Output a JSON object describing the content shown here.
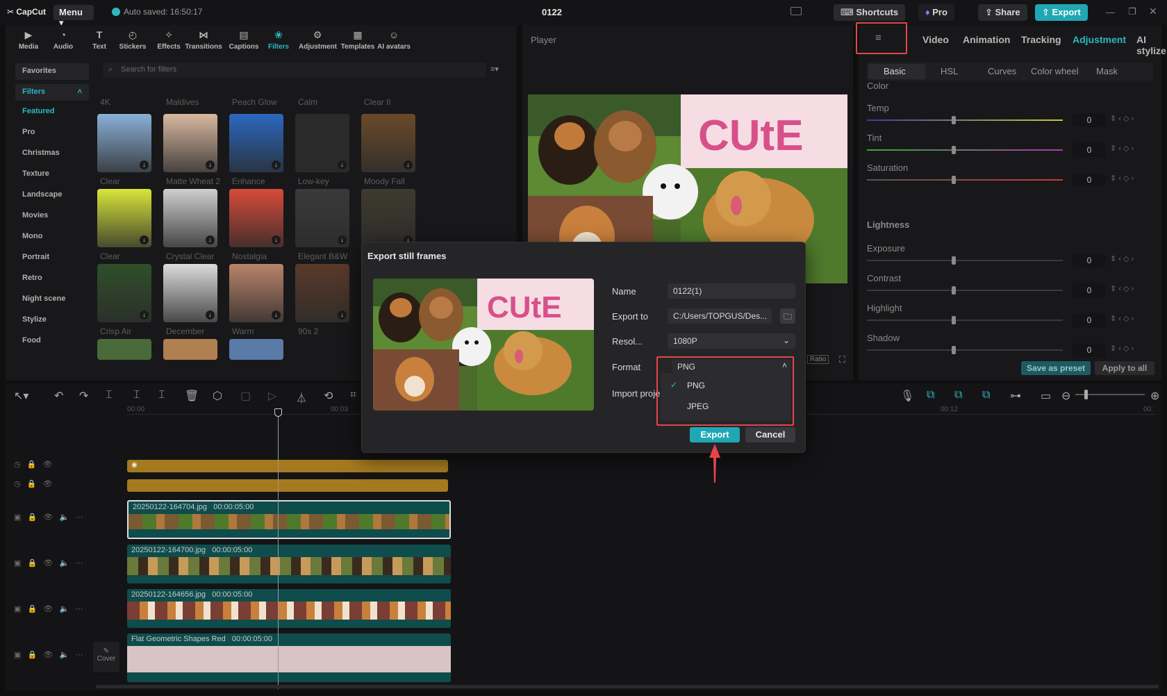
{
  "app": {
    "logo": "CapCut",
    "menu_label": "Menu",
    "autosave": "Auto saved: 16:50:17",
    "project_title": "0122",
    "shortcuts_label": "Shortcuts",
    "pro_label": "Pro",
    "share_label": "Share",
    "export_label": "Export"
  },
  "toolbar": {
    "items": [
      {
        "label": "Media",
        "icon": "media-icon"
      },
      {
        "label": "Audio",
        "icon": "audio-icon"
      },
      {
        "label": "Text",
        "icon": "text-icon"
      },
      {
        "label": "Stickers",
        "icon": "stickers-icon"
      },
      {
        "label": "Effects",
        "icon": "effects-icon"
      },
      {
        "label": "Transitions",
        "icon": "transitions-icon"
      },
      {
        "label": "Captions",
        "icon": "captions-icon"
      },
      {
        "label": "Filters",
        "icon": "filters-icon"
      },
      {
        "label": "Adjustment",
        "icon": "adjustment-icon"
      },
      {
        "label": "Templates",
        "icon": "templates-icon"
      },
      {
        "label": "AI avatars",
        "icon": "ai-avatars-icon"
      }
    ],
    "active": "Filters"
  },
  "sidebar": {
    "favorites": "Favorites",
    "filters": "Filters",
    "categories": [
      "Featured",
      "Pro",
      "Christmas",
      "Texture",
      "Landscape",
      "Movies",
      "Mono",
      "Portrait",
      "Retro",
      "Night scene",
      "Stylize",
      "Food"
    ],
    "active_category": "Featured"
  },
  "search": {
    "placeholder": "Search for filters"
  },
  "filters_grid": [
    [
      "4K",
      "Maldives",
      "Peach Glow",
      "Calm",
      "Clear II"
    ],
    [
      "Clear",
      "Matte Wheat 2",
      "Enhance",
      "Low-key",
      "Moody Fall"
    ],
    [
      "Clear",
      "Crystal Clear",
      "Nostalgia",
      "Elegant B&W",
      ""
    ],
    [
      "Crisp Air",
      "December",
      "Warm",
      "90s 2",
      ""
    ]
  ],
  "player": {
    "label": "Player",
    "ratio_label": "Ratio",
    "collage_word": "CUtE"
  },
  "right_panel": {
    "tabs": [
      "Video",
      "Animation",
      "Tracking",
      "Adjustment",
      "AI stylize"
    ],
    "active_tab": "Adjustment",
    "subtabs": [
      "Basic",
      "HSL",
      "Curves",
      "Color wheel",
      "Mask"
    ],
    "active_subtab": "Basic",
    "color_header": "Color",
    "color_sliders": [
      {
        "label": "Temp",
        "value": "0"
      },
      {
        "label": "Tint",
        "value": "0"
      },
      {
        "label": "Saturation",
        "value": "0"
      }
    ],
    "lightness_header": "Lightness",
    "lightness_sliders": [
      {
        "label": "Exposure",
        "value": "0"
      },
      {
        "label": "Contrast",
        "value": "0"
      },
      {
        "label": "Highlight",
        "value": "0"
      },
      {
        "label": "Shadow",
        "value": "0"
      }
    ],
    "save_preset": "Save as preset",
    "apply_all": "Apply to all"
  },
  "timeline": {
    "ruler": [
      "00:00",
      "00:03",
      "00:12",
      "00:"
    ],
    "clips": [
      {
        "name": "20250122-164704.jpg",
        "duration": "00:00:05:00"
      },
      {
        "name": "20250122-164700.jpg",
        "duration": "00:00:05:00"
      },
      {
        "name": "20250122-164656.jpg",
        "duration": "00:00:05:00"
      },
      {
        "name": "Flat Geometric Shapes Red",
        "duration": "00:00:05:00"
      }
    ],
    "cover_label": "Cover"
  },
  "dialog": {
    "title": "Export still frames",
    "name_label": "Name",
    "name_value": "0122(1)",
    "export_to_label": "Export to",
    "export_to_value": "C:/Users/TOPGUS/Des...",
    "resolution_label": "Resol...",
    "resolution_value": "1080P",
    "format_label": "Format",
    "format_value": "PNG",
    "import_label": "Import proje",
    "format_options": [
      "PNG",
      "JPEG"
    ],
    "selected_format": "PNG",
    "export_button": "Export",
    "cancel_button": "Cancel"
  },
  "colors": {
    "accent": "#2bb8c4",
    "highlight_box": "#e8434a",
    "panel_bg": "#18181a"
  }
}
